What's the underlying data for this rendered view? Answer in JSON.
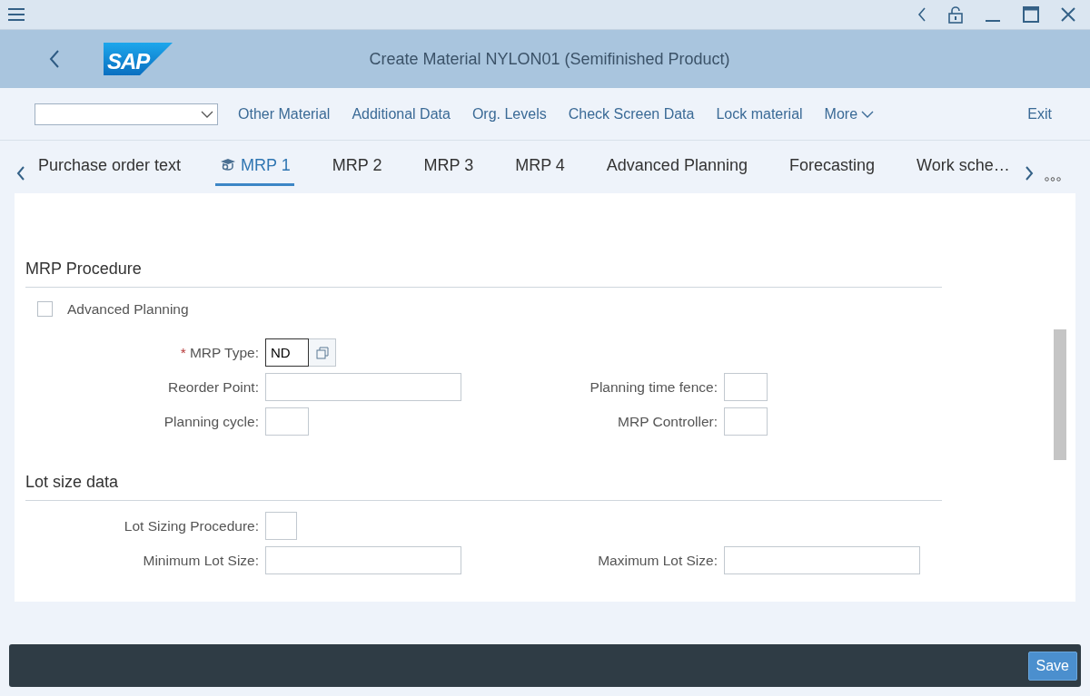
{
  "window": {
    "title": "Create Material NYLON01 (Semifinished Product)",
    "logo": "SAP"
  },
  "toolbar": {
    "actions": [
      {
        "label": "Other Material",
        "kind": "link"
      },
      {
        "label": "Additional Data",
        "kind": "link"
      },
      {
        "label": "Org. Levels",
        "kind": "link"
      },
      {
        "label": "Check Screen Data",
        "kind": "link"
      },
      {
        "label": "Lock material",
        "kind": "link"
      },
      {
        "label": "More",
        "kind": "menu"
      }
    ],
    "exit": "Exit"
  },
  "tabs": [
    {
      "label": "Purchase order text",
      "selected": false,
      "marked": false
    },
    {
      "label": "MRP 1",
      "selected": true,
      "marked": true
    },
    {
      "label": "MRP 2",
      "selected": false,
      "marked": false
    },
    {
      "label": "MRP 3",
      "selected": false,
      "marked": false
    },
    {
      "label": "MRP 4",
      "selected": false,
      "marked": false
    },
    {
      "label": "Advanced Planning",
      "selected": false,
      "marked": false
    },
    {
      "label": "Forecasting",
      "selected": false,
      "marked": false
    },
    {
      "label": "Work sche…",
      "selected": false,
      "marked": false
    }
  ],
  "sections": [
    {
      "title": "MRP Procedure",
      "rows": [
        {
          "fields": [
            {
              "kind": "checkbox",
              "label": "Advanced Planning",
              "checked": false
            }
          ]
        },
        {
          "fields": [
            {
              "kind": "help-input",
              "label": "MRP Type:",
              "required_mark": "*",
              "value": "ND",
              "focused": true
            }
          ]
        },
        {
          "fields": [
            {
              "kind": "long-input",
              "label": "Reorder Point:"
            },
            {
              "kind": "short-input",
              "label": "Planning time fence:"
            }
          ]
        },
        {
          "fields": [
            {
              "kind": "short-input",
              "label": "Planning cycle:"
            },
            {
              "kind": "short-input",
              "label": "MRP Controller:"
            }
          ]
        }
      ]
    },
    {
      "title": "Lot size data",
      "rows": [
        {
          "fields": [
            {
              "kind": "tiny-input",
              "label": "Lot Sizing Procedure:"
            }
          ]
        },
        {
          "fields": [
            {
              "kind": "long-input",
              "label": "Minimum Lot Size:"
            },
            {
              "kind": "long-input",
              "label": "Maximum Lot Size:"
            }
          ]
        }
      ]
    }
  ],
  "footer": {
    "save": "Save"
  }
}
